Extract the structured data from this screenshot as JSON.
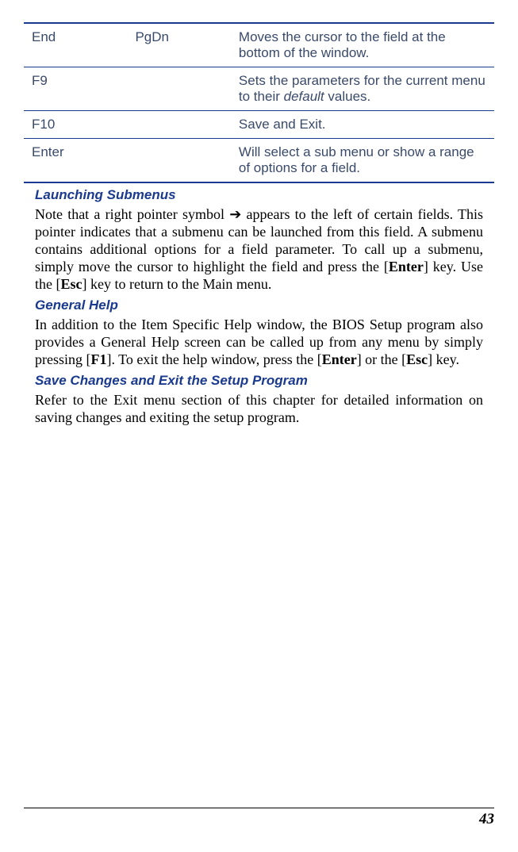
{
  "table": {
    "rows": [
      {
        "key": "End",
        "alt": "PgDn",
        "desc": "Moves the cursor to the field at the bottom of the window."
      },
      {
        "key": "F9",
        "alt": "",
        "desc_part1": "Sets the parameters for the current menu to their ",
        "desc_italic": "default",
        "desc_part2": " values."
      },
      {
        "key": "F10",
        "alt": "",
        "desc": "Save and Exit."
      },
      {
        "key": "Enter",
        "alt": "",
        "desc": "Will select a sub menu or show a range of options for a field."
      }
    ]
  },
  "sections": {
    "launching": {
      "heading": "Launching Submenus",
      "p1_part1": "Note that a right pointer symbol ",
      "p1_arrow": "➔",
      "p1_part2": " appears to the left of certain fields. This pointer indicates that a submenu can be launched from this field. A submenu contains additional options for a field parameter. To call up a submenu, simply move the cursor to highlight the field and press the [",
      "p1_enter": "Enter",
      "p1_part3": "] key. Use the [",
      "p1_esc": "Esc",
      "p1_part4": "] key to return to the Main menu."
    },
    "general": {
      "heading": "General Help",
      "p1_part1": "In addition to the Item Specific Help window, the BIOS Setup program also provides a General Help screen can be called up from any menu by simply pressing [",
      "p1_f1": "F1",
      "p1_part2": "].  To exit the help window, press the [",
      "p1_enter": "Enter",
      "p1_part3": "] or the [",
      "p1_esc": "Esc",
      "p1_part4": "] key."
    },
    "save": {
      "heading": "Save Changes and Exit the Setup Program",
      "p1": "Refer to the Exit menu section of this chapter for detailed information on saving changes and exiting the setup program."
    }
  },
  "pageNumber": "43"
}
